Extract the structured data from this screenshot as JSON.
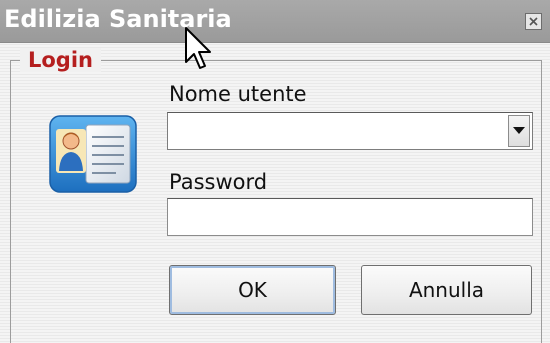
{
  "window": {
    "title": "Edilizia Sanitaria"
  },
  "titlebar": {
    "close_icon": "close-icon"
  },
  "login": {
    "legend": "Login",
    "icon": "id-card-icon",
    "username_label": "Nome utente",
    "username_value": "",
    "username_dropdown_icon": "chevron-down-icon",
    "password_label": "Password",
    "password_value": "",
    "ok_label": "OK",
    "cancel_label": "Annulla"
  },
  "colors": {
    "titlebar": "#9e9e9e",
    "legend_text": "#b51f1f",
    "background": "#f1f1f1",
    "card_blue": "#2f8fd8",
    "button_focus": "#9fbce0"
  }
}
